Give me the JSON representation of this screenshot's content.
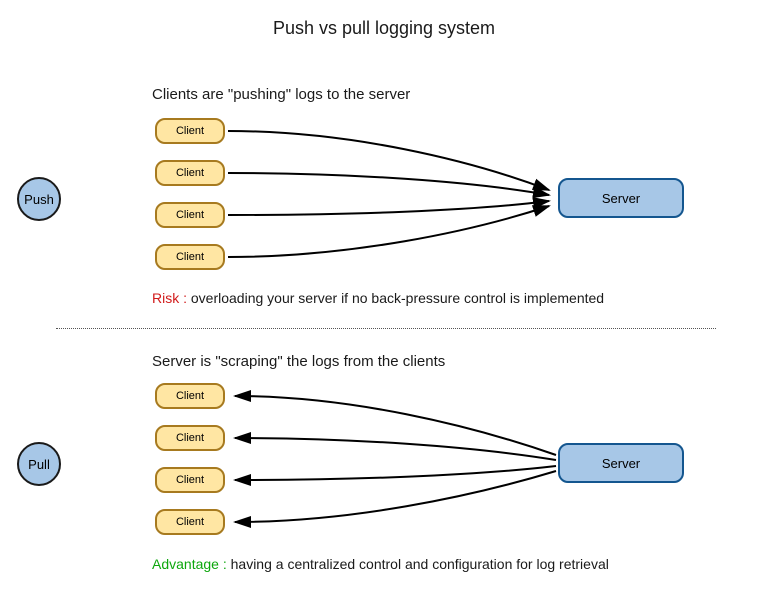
{
  "title": "Push vs pull logging system",
  "colors": {
    "client_fill": "#ffe6a3",
    "client_stroke": "#a77a1f",
    "server_fill": "#a7c7e7",
    "server_stroke": "#14568f",
    "circle_fill": "#a7c7e7",
    "risk": "#d11a1a",
    "advantage": "#0da70d"
  },
  "push": {
    "mode_label": "Push",
    "subtitle": "Clients are \"pushing\" logs to the server",
    "clients": [
      "Client",
      "Client",
      "Client",
      "Client"
    ],
    "server_label": "Server",
    "note_label": "Risk :",
    "note_text": " overloading your server if no back-pressure control is implemented"
  },
  "pull": {
    "mode_label": "Pull",
    "subtitle": "Server is \"scraping\" the logs from the clients",
    "clients": [
      "Client",
      "Client",
      "Client",
      "Client"
    ],
    "server_label": "Server",
    "note_label": "Advantage :",
    "note_text": "  having a centralized control and configuration for log retrieval"
  }
}
